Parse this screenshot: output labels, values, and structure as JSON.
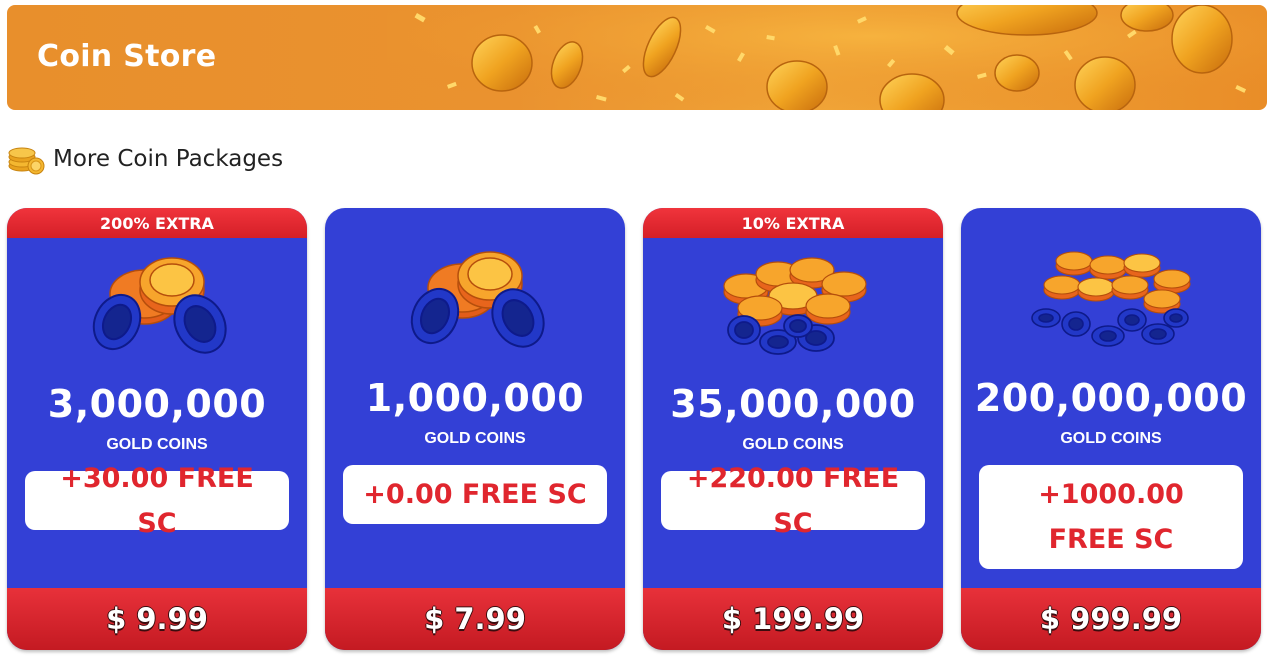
{
  "banner": {
    "title": "Coin Store"
  },
  "section": {
    "title": "More Coin Packages",
    "icon": "coin-stack-icon"
  },
  "colors": {
    "banner_orange": "#ea922f",
    "card_blue": "#3340d6",
    "accent_red": "#e0262e",
    "gold": "#f5b21c"
  },
  "packages": [
    {
      "ribbon": "200% EXTRA",
      "amount": "3,000,000",
      "unit": "GOLD COINS",
      "bonus": "+30.00 FREE SC",
      "price": "$ 9.99",
      "art": "coin-pile-small-icon"
    },
    {
      "ribbon": "",
      "amount": "1,000,000",
      "unit": "GOLD COINS",
      "bonus": "+0.00 FREE SC",
      "price": "$ 7.99",
      "art": "coin-pile-small-icon"
    },
    {
      "ribbon": "10% EXTRA",
      "amount": "35,000,000",
      "unit": "GOLD COINS",
      "bonus": "+220.00 FREE SC",
      "price": "$ 199.99",
      "art": "coin-pile-medium-icon"
    },
    {
      "ribbon": "",
      "amount": "200,000,000",
      "unit": "GOLD COINS",
      "bonus": "+1000.00 FREE SC",
      "price": "$ 999.99",
      "art": "coin-pile-large-icon"
    }
  ]
}
